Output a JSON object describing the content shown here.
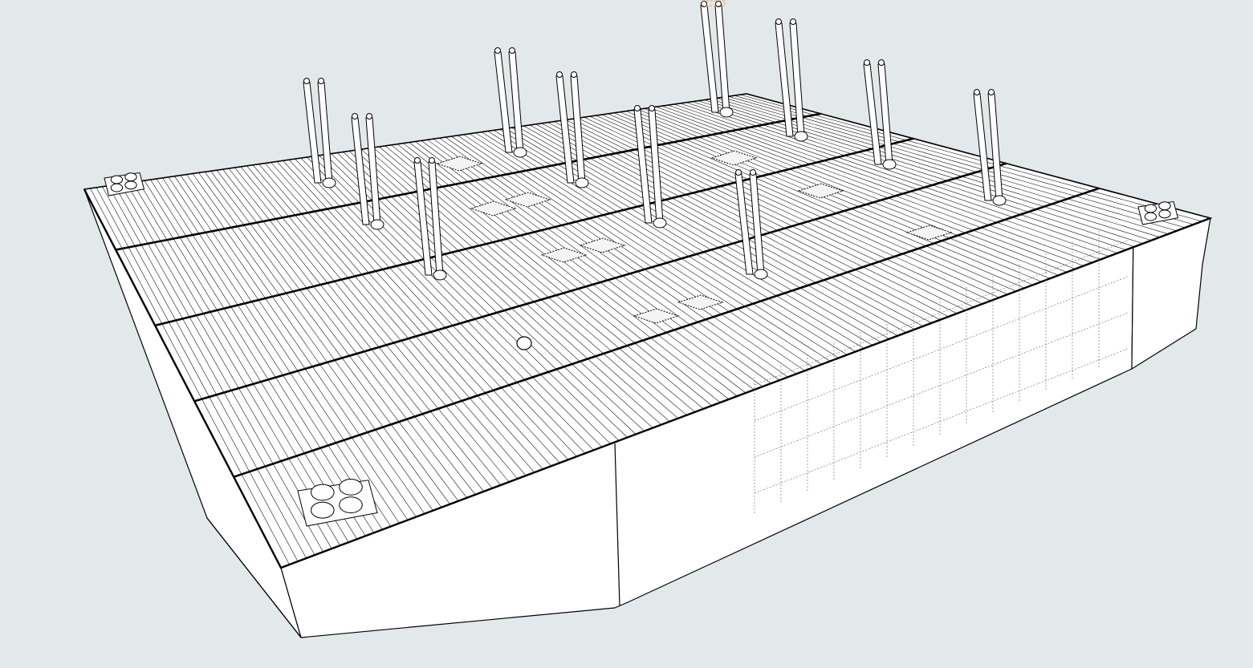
{
  "viewport": {
    "background_color": "#e3e8ea",
    "line_color": "#000000",
    "face_color": "#ffffff",
    "axis_marker_color": "#e0a060",
    "model": "pontoon-barge-deck",
    "icons": {
      "origin_axis": "axis-marker-icon",
      "cleat": "bollard-icon",
      "post": "mast-post-icon",
      "hatch": "hatch-icon"
    }
  }
}
